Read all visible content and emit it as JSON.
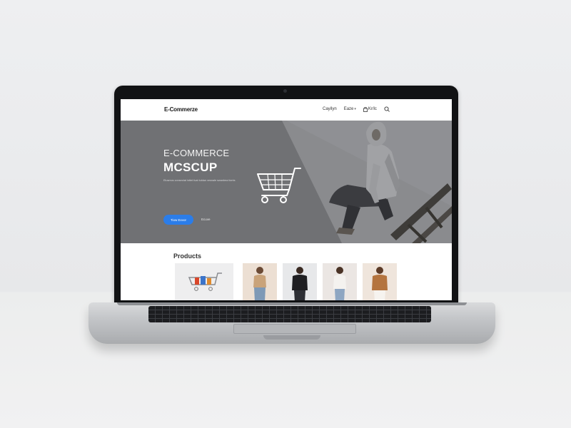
{
  "site": {
    "brand": "E-Commerze",
    "nav": {
      "links": [
        "Cayilyn",
        "Eaze"
      ],
      "cart_label": "Kr/lc",
      "search_icon": "search-icon",
      "bag_icon": "bag-icon",
      "chevron_icon": "chevron-down-icon"
    },
    "hero": {
      "title_line1": "E-COMMERCE",
      "title_line2": "MCSCUP",
      "subtitle": "Elusmos consectat inttet fuat tuldan vesnale swanbea tionts",
      "primary_button": "Tiow Exvor",
      "secondary_link": "Ecuve",
      "cart_icon": "shopping-cart-icon"
    },
    "products": {
      "heading": "Products",
      "cards": [
        {
          "icon": "shopping-cart-product-image"
        },
        {
          "icon": "model-tan-top-image"
        },
        {
          "icon": "model-black-sweater-image"
        },
        {
          "icon": "model-white-top-image"
        },
        {
          "icon": "model-brown-sweater-image"
        }
      ]
    }
  },
  "colors": {
    "accent": "#2b7de9",
    "hero_bg": "#707174",
    "laptop_bezel": "#111214"
  }
}
